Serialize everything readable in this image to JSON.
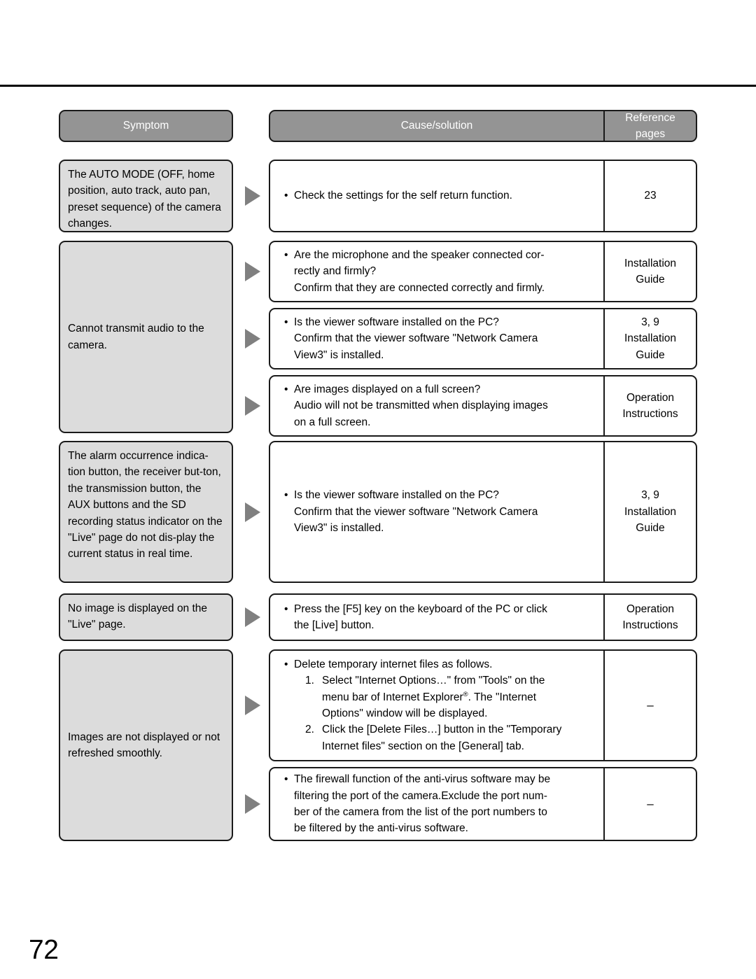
{
  "page": {
    "number": "72"
  },
  "table": {
    "header": {
      "symptom": "Symptom",
      "cause": "Cause/solution",
      "reference": "Reference\npages"
    },
    "rows": [
      {
        "symptom": "The AUTO MODE (OFF, home position, auto track, auto pan, preset sequence) of the camera changes.",
        "entries": [
          {
            "bullet": "Check the settings for the self return function.",
            "continuation": [],
            "reference": "23"
          }
        ]
      },
      {
        "symptom": "Cannot transmit audio to the camera.",
        "entries": [
          {
            "bullet": "Are the microphone and the speaker connected cor-",
            "continuation": [
              "rectly and firmly?",
              "Confirm that they are connected correctly and firmly."
            ],
            "reference": "Installation\nGuide"
          },
          {
            "bullet": "Is the viewer software installed on the PC?",
            "continuation": [
              "Confirm that the viewer software \"Network Camera",
              "View3\" is installed."
            ],
            "reference": "3, 9\nInstallation\nGuide"
          },
          {
            "bullet": "Are images displayed on a full screen?",
            "continuation": [
              "Audio will not be transmitted when displaying images",
              "on a full screen."
            ],
            "reference": "Operation\nInstructions"
          }
        ]
      },
      {
        "symptom": "The alarm occurrence indica-tion button, the receiver but-ton, the transmission button, the AUX buttons and the SD recording status indicator on the \"Live\" page do not dis-play the current status in real time.",
        "entries": [
          {
            "bullet": "Is the viewer software installed on the PC?",
            "continuation": [
              "Confirm that the viewer software \"Network Camera",
              "View3\" is installed."
            ],
            "reference": "3, 9\nInstallation\nGuide"
          }
        ]
      },
      {
        "symptom": "No image is displayed on the \"Live\" page.",
        "entries": [
          {
            "bullet": "Press the [F5] key on the keyboard of the PC or click",
            "continuation": [
              "the [Live] button."
            ],
            "reference": "Operation\nInstructions"
          }
        ]
      },
      {
        "symptom": "Images are not displayed or not refreshed smoothly.",
        "entries": [
          {
            "bullet": "Delete temporary internet files as follows.",
            "continuation": [],
            "steps": [
              {
                "lines": [
                  "Select \"Internet Options…\" from \"Tools\" on the",
                  "menu bar of Internet Explorer|REG|. The \"Internet",
                  "Options\" window will be displayed."
                ]
              },
              {
                "lines": [
                  "Click the [Delete Files…] button in the \"Temporary",
                  "Internet files\" section on the [General] tab."
                ]
              }
            ],
            "reference": "–"
          },
          {
            "bullet": "The firewall function of the anti-virus software may be",
            "continuation": [
              "filtering the port of the camera.Exclude the port num-",
              "ber of the camera from the list of the port numbers to",
              "be filtered by the anti-virus software."
            ],
            "reference": "–"
          }
        ]
      }
    ]
  },
  "colors": {
    "header_fill": "#949494",
    "symptom_fill": "#dcdcdc",
    "arrow_fill": "#808080",
    "border": "#1a1a1a"
  }
}
